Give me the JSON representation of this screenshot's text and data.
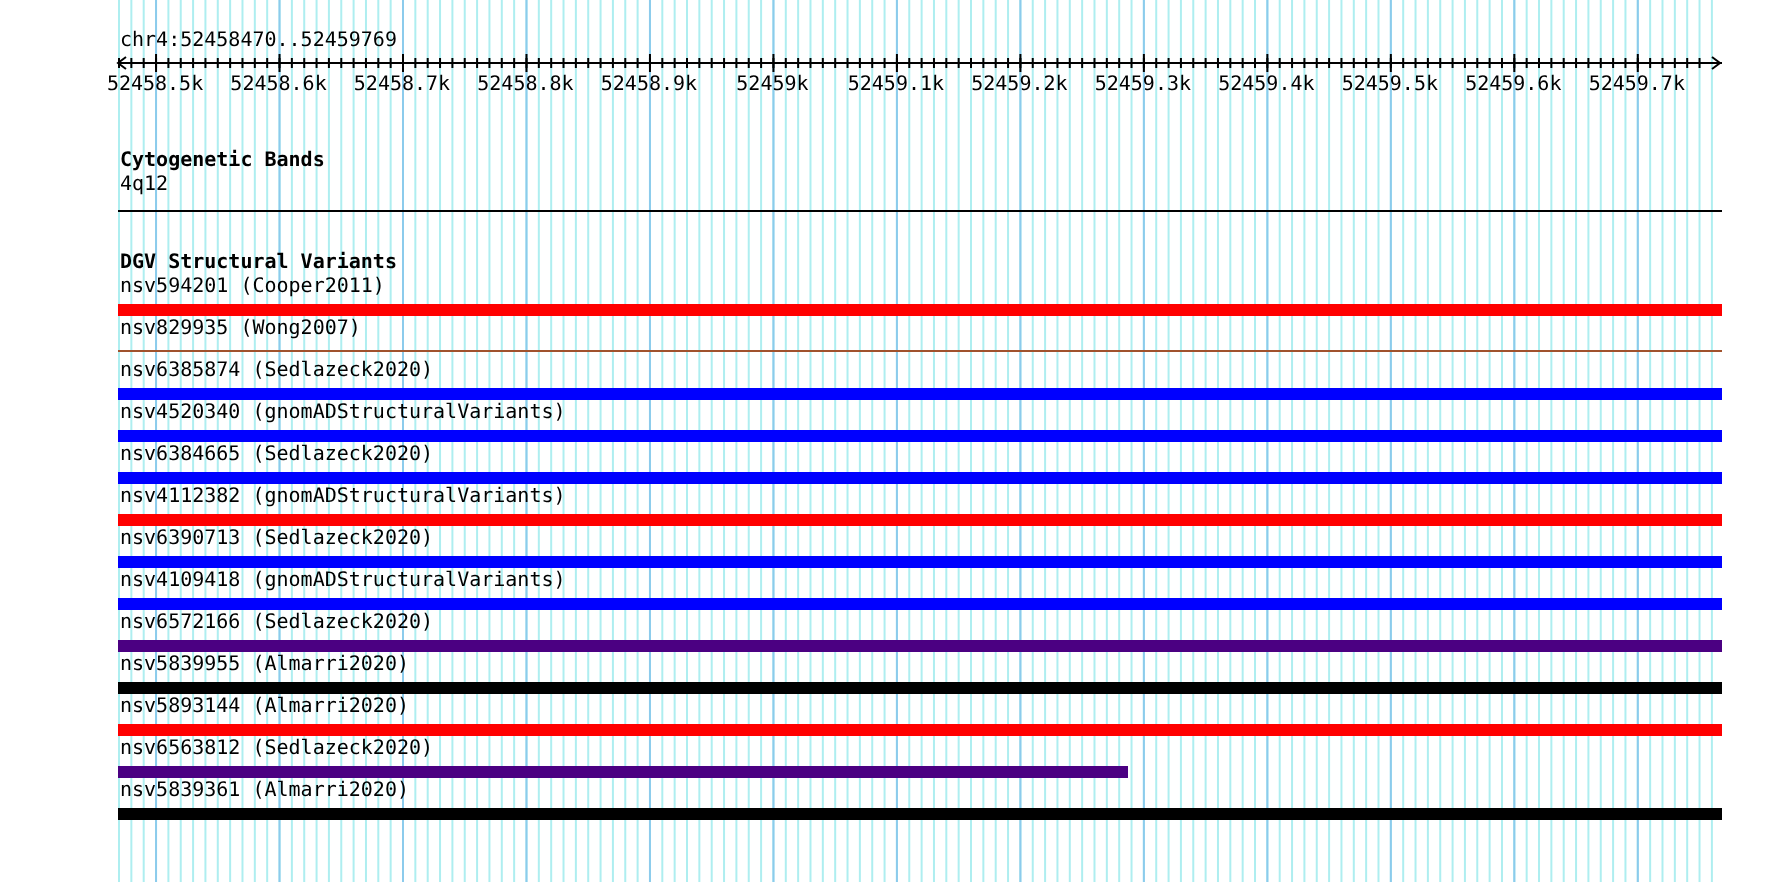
{
  "ruler": {
    "location": "chr4:52458470..52459769",
    "ticks": [
      "52458.5k",
      "52458.6k",
      "52458.7k",
      "52458.8k",
      "52458.9k",
      "52459k",
      "52459.1k",
      "52459.2k",
      "52459.3k",
      "52459.4k",
      "52459.5k",
      "52459.6k",
      "52459.7k"
    ]
  },
  "cytoband_track": {
    "title": "Cytogenetic Bands",
    "band": "4q12"
  },
  "variant_track": {
    "title": "DGV Structural Variants",
    "features": [
      {
        "label": "nsv594201 (Cooper2011)",
        "kind": "bar",
        "color": "#ff0000"
      },
      {
        "label": "nsv829935 (Wong2007)",
        "kind": "line",
        "color": "#a0522d"
      },
      {
        "label": "nsv6385874 (Sedlazeck2020)",
        "kind": "bar",
        "color": "#0000ff"
      },
      {
        "label": "nsv4520340 (gnomADStructuralVariants)",
        "kind": "bar",
        "color": "#0000ff"
      },
      {
        "label": "nsv6384665 (Sedlazeck2020)",
        "kind": "bar",
        "color": "#0000ff"
      },
      {
        "label": "nsv4112382 (gnomADStructuralVariants)",
        "kind": "bar",
        "color": "#ff0000"
      },
      {
        "label": "nsv6390713 (Sedlazeck2020)",
        "kind": "bar",
        "color": "#0000ff"
      },
      {
        "label": "nsv4109418 (gnomADStructuralVariants)",
        "kind": "bar",
        "color": "#0000ff"
      },
      {
        "label": "nsv6572166 (Sedlazeck2020)",
        "kind": "bar",
        "color": "#4b0082"
      },
      {
        "label": "nsv5839955 (Almarri2020)",
        "kind": "bar",
        "color": "#000000"
      },
      {
        "label": "nsv5893144 (Almarri2020)",
        "kind": "bar",
        "color": "#ff0000"
      },
      {
        "label": "nsv6563812 (Sedlazeck2020)",
        "kind": "partial",
        "color": "#4b0082"
      },
      {
        "label": "nsv5839361 (Almarri2020)",
        "kind": "bar",
        "color": "#000000"
      }
    ]
  }
}
